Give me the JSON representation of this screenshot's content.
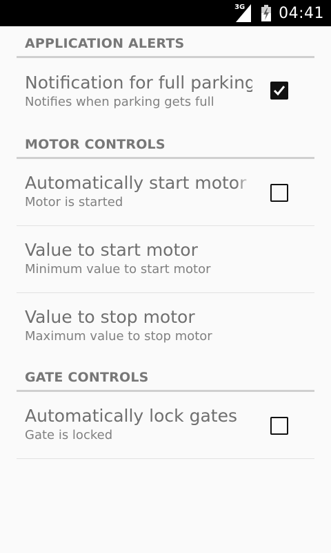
{
  "status_bar": {
    "network": "3G",
    "time": "04:41",
    "signal_icon": "signal-bars-icon",
    "battery_icon": "battery-charging-icon"
  },
  "sections": {
    "application_alerts": {
      "header": "APPLICATION ALERTS",
      "items": [
        {
          "title": "Notification for full parking",
          "summary": "Notifies when parking gets full",
          "checked": true
        }
      ]
    },
    "motor_controls": {
      "header": "MOTOR CONTROLS",
      "items": [
        {
          "title": "Automatically start motor",
          "summary": "Motor is started",
          "checked": false
        },
        {
          "title": "Value to start motor",
          "summary": "Minimum value to start motor"
        },
        {
          "title": "Value to stop motor",
          "summary": "Maximum value to stop motor"
        }
      ]
    },
    "gate_controls": {
      "header": "GATE CONTROLS",
      "items": [
        {
          "title": "Automatically lock gates",
          "summary": "Gate is locked",
          "checked": false
        }
      ]
    }
  },
  "colors": {
    "background": "#fafafa",
    "status_bar": "#000000",
    "header_text": "#777777",
    "divider": "#cfcfcf",
    "title_text": "#6f6f6f"
  }
}
